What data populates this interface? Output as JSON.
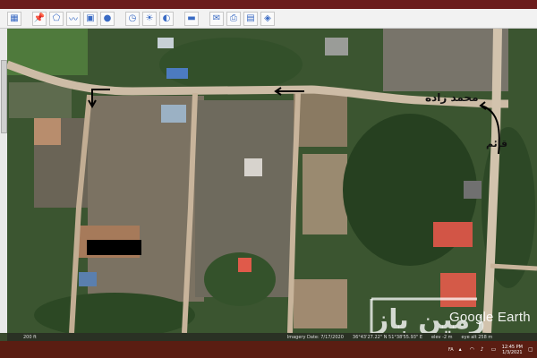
{
  "toolbar": {
    "icons": [
      "sidebar-toggle-icon",
      "add-placemark-icon",
      "add-polygon-icon",
      "add-path-icon",
      "add-overlay-icon",
      "record-tour-icon",
      "historical-imagery-icon",
      "sunlight-icon",
      "planets-icon",
      "ruler-icon",
      "email-icon",
      "print-icon",
      "save-image-icon",
      "view-in-maps-icon"
    ]
  },
  "map": {
    "labels": {
      "street_name": "محمد زاده",
      "side_street": "قائم"
    },
    "watermark_text": "زمین باز",
    "attribution": "Google Earth"
  },
  "statusbar": {
    "scale": "200 ft",
    "imagery_date": "Imagery Date: 7/17/2020",
    "coords": "36°43'27.22\" N  51°38'55.93\" E",
    "elevation": "elev   -2 m",
    "eye_alt": "eye alt  258 m"
  },
  "taskbar": {
    "language": "FA",
    "time": "12:45 PM",
    "date": "1/3/2021"
  },
  "colors": {
    "road": "#cdbca6",
    "vegetation_dark": "#2f4a26",
    "vegetation_light": "#4d6b3a",
    "taskbar": "#5a1d12"
  }
}
